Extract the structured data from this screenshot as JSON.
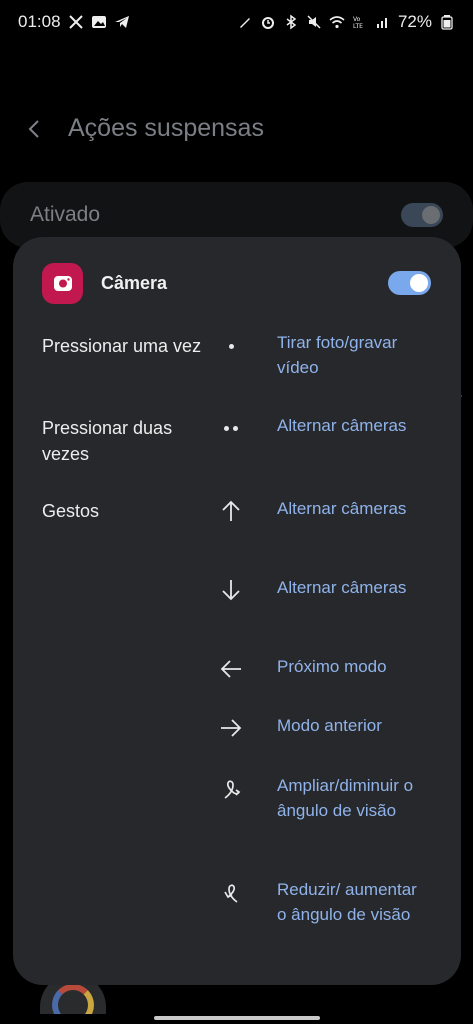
{
  "status_bar": {
    "time": "01:08",
    "battery": "72%",
    "left_icons": [
      "missed-call-icon",
      "gallery-icon",
      "telegram-icon"
    ],
    "right_icons": [
      "pen-icon",
      "alarm-icon",
      "bluetooth-icon",
      "mute-icon",
      "wifi-icon",
      "volte-icon",
      "signal-icon",
      "battery-icon"
    ]
  },
  "background": {
    "title": "Ações suspensas",
    "toggle_label": "Ativado",
    "toggle_on": true
  },
  "popup": {
    "app_name": "Câmera",
    "app_icon": "camera-app-icon",
    "toggle_on": true,
    "accent_color": "#8fb3ea",
    "app_icon_color": "#c0184f",
    "rows": {
      "single_press": {
        "label": "Pressionar uma vez",
        "icon": "single-dot-icon",
        "action": "Tirar foto/gravar vídeo"
      },
      "double_press": {
        "label": "Pressionar duas vezes",
        "icon": "double-dot-icon",
        "action": "Alternar câmeras"
      },
      "gestures": {
        "label": "Gestos",
        "items": [
          {
            "icon": "arrow-up-icon",
            "action": "Alternar câmeras"
          },
          {
            "icon": "arrow-down-icon",
            "action": "Alternar câmeras"
          },
          {
            "icon": "arrow-left-icon",
            "action": "Próximo modo"
          },
          {
            "icon": "arrow-right-icon",
            "action": "Modo anterior"
          },
          {
            "icon": "loop-gesture-icon",
            "action": "Ampliar/diminuir o ângulo de visão"
          },
          {
            "icon": "loop-gesture-reverse-icon",
            "action": "Reduzir/ aumentar o ângulo de visão"
          }
        ]
      }
    }
  }
}
